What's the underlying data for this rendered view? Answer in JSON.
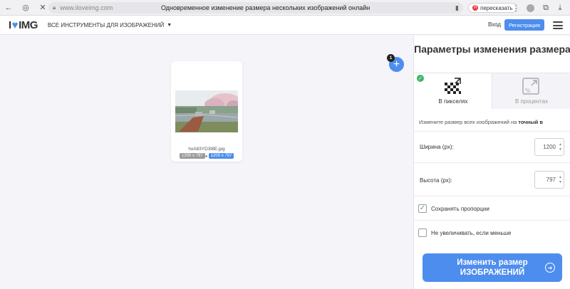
{
  "browser": {
    "url": "www.iloveimg.com",
    "tab_title": "Одновременное изменение размера нескольких изображений онлайн",
    "retell_label": "пересказать",
    "retell_badge": "Я"
  },
  "header": {
    "logo_left": "I",
    "logo_heart": "♥",
    "logo_right": "IMG",
    "tools_menu": "ВСЕ ИНСТРУМЕНТЫ ДЛЯ ИЗОБРАЖЕНИЙ",
    "login": "Вход",
    "signup": "Регистрация"
  },
  "file": {
    "name": "hxA83YD3t8E.jpg",
    "original_size": "1200 x 797",
    "new_size": "1200 x 797"
  },
  "add_button": {
    "symbol": "+",
    "count": "1"
  },
  "panel": {
    "title": "Параметры изменения размера",
    "tab_pixels": "В пикселях",
    "tab_percent": "В процентах",
    "hint_prefix": "Измените размер всех изображений на",
    "hint_bold": "точный в",
    "width_label": "Ширина (px):",
    "width_value": "1200",
    "height_label": "Высота (px):",
    "height_value": "797",
    "keep_ratio_label": "Сохранять пропорции",
    "keep_ratio_checked": true,
    "no_enlarge_label": "Не увеличивать, если меньше",
    "no_enlarge_checked": false,
    "resize_button": "Изменить размер ИЗОБРАЖЕНИЙ"
  },
  "colors": {
    "accent": "#4d8dee",
    "check_green": "#3fb86a",
    "background": "#f4f4f9"
  }
}
